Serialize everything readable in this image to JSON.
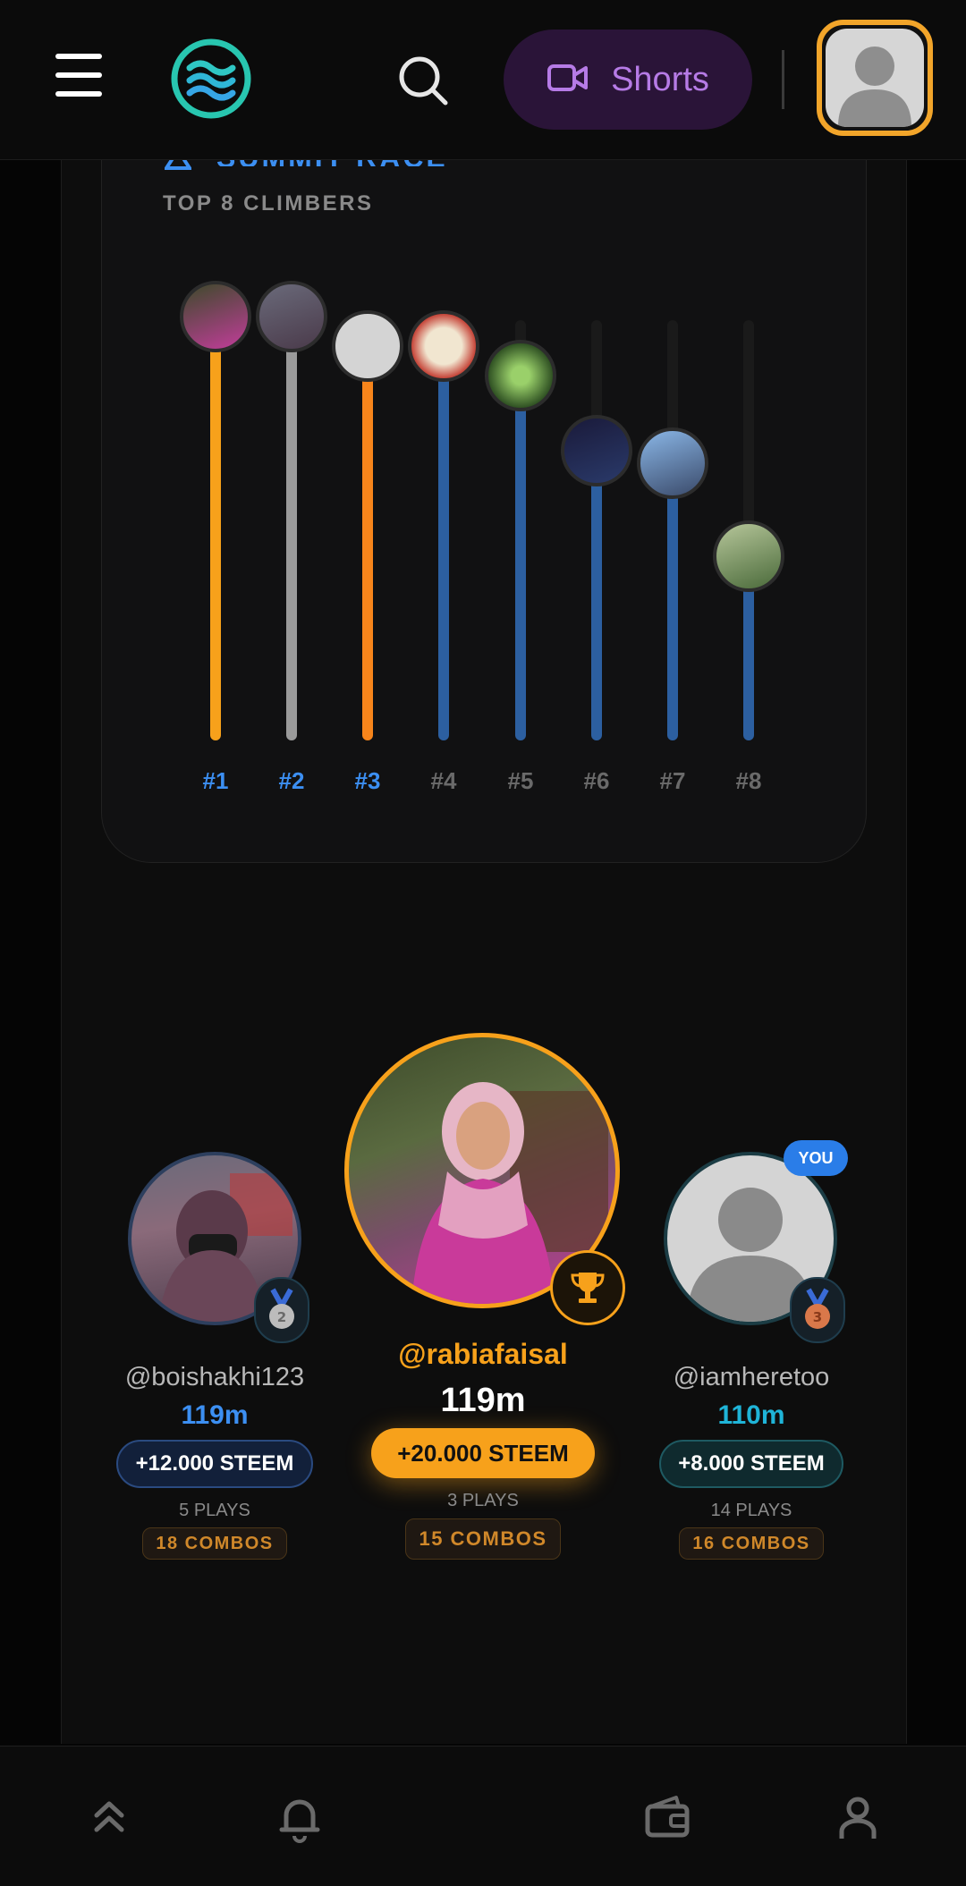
{
  "header": {
    "shorts_label": "Shorts"
  },
  "race": {
    "title": "SUMMIT RACE",
    "subtitle": "TOP 8 CLIMBERS",
    "climbers": [
      {
        "rank": "#1",
        "progress": 1.0,
        "color": "#f7a11b"
      },
      {
        "rank": "#2",
        "progress": 1.0,
        "color": "#9a9a9a"
      },
      {
        "rank": "#3",
        "progress": 0.93,
        "color": "#f7851b"
      },
      {
        "rank": "#4",
        "progress": 0.93,
        "color": "#2c5fa0"
      },
      {
        "rank": "#5",
        "progress": 0.86,
        "color": "#2c5fa0"
      },
      {
        "rank": "#6",
        "progress": 0.68,
        "color": "#2c5fa0"
      },
      {
        "rank": "#7",
        "progress": 0.65,
        "color": "#2c5fa0"
      },
      {
        "rank": "#8",
        "progress": 0.43,
        "color": "#2c5fa0"
      }
    ],
    "rank_colors": {
      "top": "#3c8ff2",
      "rest": "#6a6a6a"
    }
  },
  "podium": {
    "first": {
      "name": "@rabiafaisal",
      "distance": "119m",
      "reward": "+20.000 STEEM",
      "plays": "3 PLAYS",
      "combos": "15 COMBOS"
    },
    "second": {
      "name": "@boishakhi123",
      "distance": "119m",
      "reward": "+12.000 STEEM",
      "plays": "5 PLAYS",
      "combos": "18 COMBOS"
    },
    "third": {
      "name": "@iamheretoo",
      "distance": "110m",
      "reward": "+8.000 STEEM",
      "plays": "14 PLAYS",
      "combos": "16 COMBOS",
      "badge": "YOU"
    }
  },
  "colors": {
    "accent": "#f7a11b",
    "blue": "#3c8ff2",
    "teal": "#1fb4d8"
  }
}
